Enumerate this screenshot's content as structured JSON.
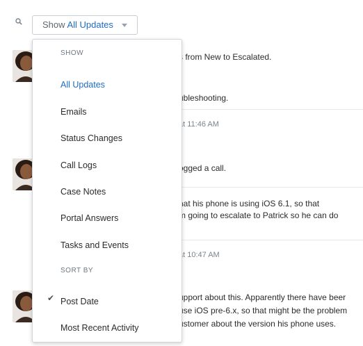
{
  "filter": {
    "prefix": "Show",
    "selected": "All Updates"
  },
  "menu": {
    "show_header": "SHOW",
    "show_items": [
      "All Updates",
      "Emails",
      "Status Changes",
      "Call Logs",
      "Case Notes",
      "Portal Answers",
      "Tasks and Events"
    ],
    "sort_header": "SORT BY",
    "sort_items": [
      "Post Date",
      "Most Recent Activity"
    ],
    "checked_sort": "Post Date",
    "active_show": "All Updates"
  },
  "feed": {
    "lines": {
      "status_changed": "s from New to Escalated.",
      "troubleshooting": "ubleshooting.",
      "time1": "at 11:46 AM",
      "logged_call": "ogged a call.",
      "phone_ios": "hat his phone is using iOS 6.1, so that",
      "escalate": "m going to escalate to Patrick so he can do",
      "time2": "at 10:47 AM",
      "support": "upport about this. Apparently there have beer",
      "ios_pre": "use iOS pre-6.x, so that might be the problem",
      "customer": "ustomer about the version his phone uses."
    }
  },
  "colors": {
    "accent": "#1f6cc4",
    "divider": "#e6e9ec"
  }
}
